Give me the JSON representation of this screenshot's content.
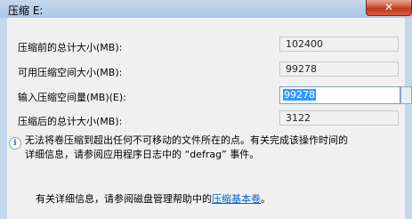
{
  "window": {
    "title": "压缩 E:",
    "close_glyph": "✕"
  },
  "fields": {
    "total_before": {
      "label": "压缩前的总计大小(MB):",
      "value": "102400"
    },
    "available": {
      "label": "可用压缩空间大小(MB):",
      "value": "99278"
    },
    "shrink_amount": {
      "label": "输入压缩空间量(MB)(E):",
      "value": "99278"
    },
    "total_after": {
      "label": "压缩后的总计大小(MB):",
      "value": "3122"
    }
  },
  "info": {
    "icon": "info-icon",
    "line1": "无法将卷压缩到超出任何不可移动的文件所在的点。有关完成该操作时间的",
    "line2": "详细信息，请参阅应用程序日志中的 “defrag” 事件。"
  },
  "help": {
    "text": "有关详细信息，请参阅磁盘管理帮助中的",
    "link": "压缩基本卷",
    "suffix": "。"
  },
  "colors": {
    "accent": "#3399ff",
    "link": "#0066cc",
    "close": "#c0391e"
  }
}
